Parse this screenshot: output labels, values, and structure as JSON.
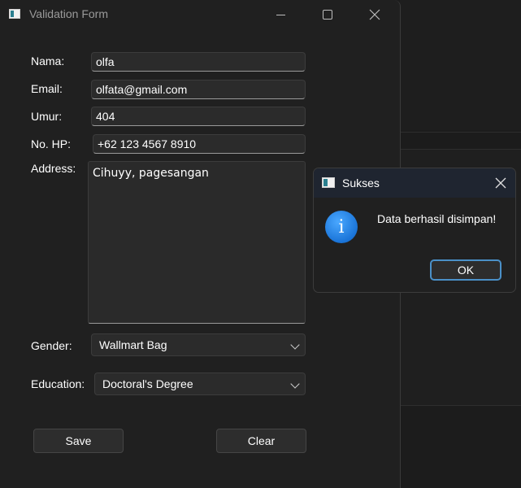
{
  "main_window": {
    "title": "Validation Form",
    "labels": {
      "nama": "Nama:",
      "email": "Email:",
      "umur": "Umur:",
      "no_hp": "No. HP:",
      "address": "Address:",
      "gender": "Gender:",
      "education": "Education:"
    },
    "values": {
      "nama": "olfa",
      "email": "olfata@gmail.com",
      "umur": "404",
      "no_hp": "+62 123 4567 8910",
      "address": "Cihuyy, pagesangan",
      "gender": "Wallmart Bag",
      "education": "Doctoral's Degree"
    },
    "buttons": {
      "save": "Save",
      "clear": "Clear"
    }
  },
  "dialog": {
    "title": "Sukses",
    "message": "Data berhasil disimpan!",
    "ok": "OK",
    "icon": "info-icon"
  },
  "colors": {
    "dialog_button_accent": "#4a90c8",
    "info_icon": "#1a74d8"
  }
}
